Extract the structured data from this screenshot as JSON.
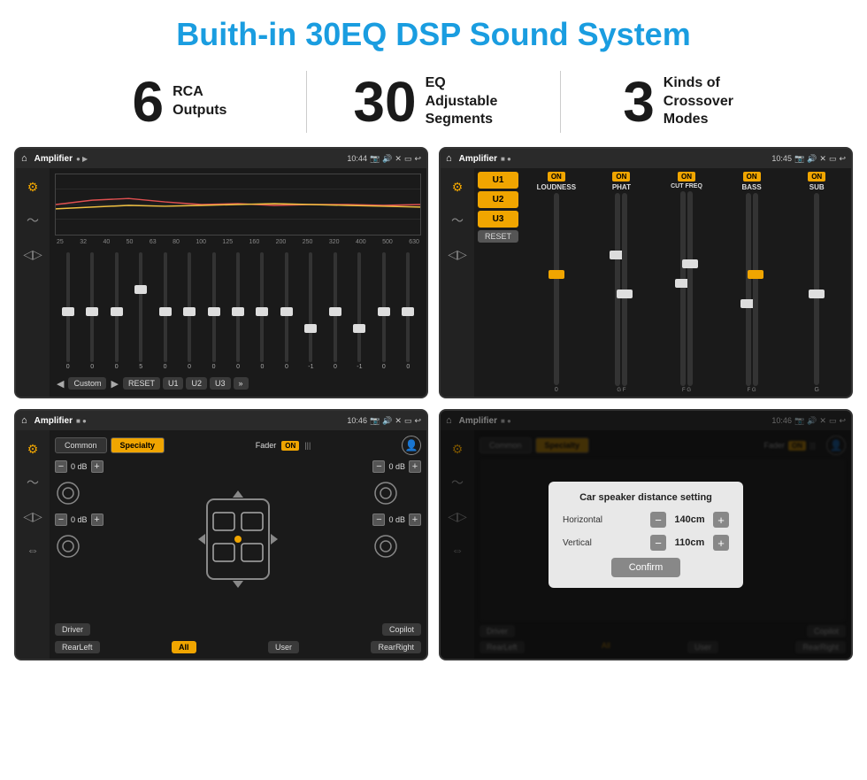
{
  "page": {
    "title": "Buith-in 30EQ DSP Sound System"
  },
  "stats": [
    {
      "number": "6",
      "text": "RCA\nOutputs"
    },
    {
      "number": "30",
      "text": "EQ Adjustable\nSegments"
    },
    {
      "number": "3",
      "text": "Kinds of\nCrossover Modes"
    }
  ],
  "screens": [
    {
      "id": "screen1",
      "app": "Amplifier",
      "time": "10:44",
      "type": "eq",
      "eq_labels": [
        "25",
        "32",
        "40",
        "50",
        "63",
        "80",
        "100",
        "125",
        "160",
        "200",
        "250",
        "320",
        "400",
        "500",
        "630"
      ],
      "eq_values": [
        "0",
        "0",
        "0",
        "5",
        "0",
        "0",
        "0",
        "0",
        "0",
        "0",
        "-1",
        "0",
        "-1",
        "",
        ""
      ],
      "presets": [
        "Custom",
        "RESET",
        "U1",
        "U2",
        "U3"
      ]
    },
    {
      "id": "screen2",
      "app": "Amplifier",
      "time": "10:45",
      "type": "channels",
      "u_buttons": [
        "U1",
        "U2",
        "U3"
      ],
      "channels": [
        "LOUDNESS",
        "PHAT",
        "CUT FREQ",
        "BASS",
        "SUB"
      ],
      "on_labels": [
        "ON",
        "ON",
        "ON",
        "ON",
        "ON"
      ],
      "reset_label": "RESET"
    },
    {
      "id": "screen3",
      "app": "Amplifier",
      "time": "10:46",
      "type": "fader",
      "tabs": [
        "Common",
        "Specialty"
      ],
      "active_tab": "Specialty",
      "fader_label": "Fader",
      "fader_on": "ON",
      "db_rows": [
        {
          "left": "0 dB",
          "right": "0 dB"
        },
        {
          "left": "0 dB",
          "right": "0 dB"
        }
      ],
      "bottom_buttons": [
        "Driver",
        "All",
        "RearLeft",
        "User",
        "RearRight",
        "Copilot"
      ]
    },
    {
      "id": "screen4",
      "app": "Amplifier",
      "time": "10:46",
      "type": "dialog",
      "tabs": [
        "Common",
        "Specialty"
      ],
      "dialog": {
        "title": "Car speaker distance setting",
        "rows": [
          {
            "label": "Horizontal",
            "value": "140cm"
          },
          {
            "label": "Vertical",
            "value": "110cm"
          }
        ],
        "confirm_label": "Confirm"
      },
      "bottom_buttons": [
        "Driver",
        "RearLeft",
        "User",
        "RearRight",
        "Copilot"
      ]
    }
  ]
}
